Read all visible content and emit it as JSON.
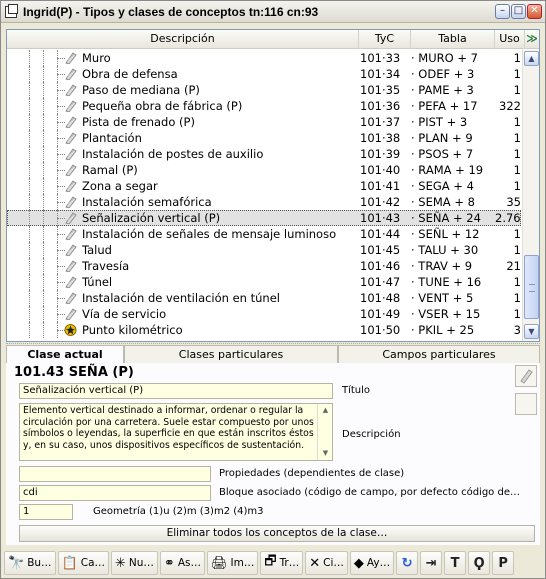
{
  "window": {
    "title": "Ingrid(P) - Tipos y clases de conceptos tn:116 cn:93",
    "minimize": "–",
    "maximize": "□",
    "close": "✕"
  },
  "grid": {
    "columns": {
      "descripcion": "Descripción",
      "tyc": "TyC",
      "tabla": "Tabla",
      "uso": "Uso",
      "extra": "≫"
    },
    "rows": [
      {
        "label": "Muro",
        "tyc": "101·33",
        "tabla": "· MURO + 7",
        "uso": "1"
      },
      {
        "label": "Obra de defensa",
        "tyc": "101·34",
        "tabla": "· ODEF + 3",
        "uso": "1"
      },
      {
        "label": "Paso de mediana (P)",
        "tyc": "101·35",
        "tabla": "· PAME + 3",
        "uso": "1"
      },
      {
        "label": "Pequeña obra de fábrica (P)",
        "tyc": "101·36",
        "tabla": "· PEFA + 17",
        "uso": "322"
      },
      {
        "label": "Pista de frenado (P)",
        "tyc": "101·37",
        "tabla": "· PIST + 3",
        "uso": "1"
      },
      {
        "label": "Plantación",
        "tyc": "101·38",
        "tabla": "· PLAN + 9",
        "uso": "1"
      },
      {
        "label": "Instalación de postes de auxilio",
        "tyc": "101·39",
        "tabla": "· PSOS + 7",
        "uso": "1"
      },
      {
        "label": "Ramal (P)",
        "tyc": "101·40",
        "tabla": "· RAMA + 19",
        "uso": "1"
      },
      {
        "label": "Zona a segar",
        "tyc": "101·41",
        "tabla": "· SEGA + 4",
        "uso": "1"
      },
      {
        "label": "Instalación semafórica",
        "tyc": "101·42",
        "tabla": "· SEMA + 8",
        "uso": "35"
      },
      {
        "label": "Señalización vertical (P)",
        "tyc": "101·43",
        "tabla": "· SEÑA + 24",
        "uso": "2.765",
        "selected": true
      },
      {
        "label": "Instalación de señales de mensaje luminoso",
        "tyc": "101·44",
        "tabla": "· SEÑL + 12",
        "uso": "1"
      },
      {
        "label": "Talud",
        "tyc": "101·45",
        "tabla": "· TALU + 30",
        "uso": "1"
      },
      {
        "label": "Travesía",
        "tyc": "101·46",
        "tabla": "· TRAV + 9",
        "uso": "21"
      },
      {
        "label": "Túnel",
        "tyc": "101·47",
        "tabla": "· TUNE + 16",
        "uso": "1"
      },
      {
        "label": "Instalación de ventilación en túnel",
        "tyc": "101·48",
        "tabla": "· VENT + 5",
        "uso": "1"
      },
      {
        "label": "Vía de servicio",
        "tyc": "101·49",
        "tabla": "· VSER + 15",
        "uso": "1"
      },
      {
        "label": "Punto kilométrico",
        "tyc": "101·50",
        "tabla": "· PKIL + 25",
        "uso": "3",
        "icon": "star"
      }
    ]
  },
  "tabs": [
    "Clase actual",
    "Clases particulares",
    "Campos particulares"
  ],
  "detail": {
    "heading": "101.43 SEÑA (P)",
    "title_value": "Señalización vertical (P)",
    "title_label": "Título",
    "description_text": "Elemento vertical destinado a informar, ordenar o regular la circulación por una carretera. Suele estar compuesto por unos símbolos o leyendas, la superficie en que están inscritos éstos y, en su caso, unos dispositivos específicos de sustentación.",
    "description_label": "Descripción",
    "properties_value": "",
    "properties_label": "Propiedades (dependientes de clase)",
    "block_value": "cdi",
    "block_label": "Bloque asociado (código de campo, por defecto código de…",
    "geometry_value": "1",
    "geometry_label": "Geometría (1)u (2)m (3)m2 (4)m3",
    "delete_button": "Eliminar todos los conceptos de la clase…"
  },
  "toolbar": [
    {
      "glyph": "🔭",
      "label": "Bu…"
    },
    {
      "glyph": "📋",
      "label": "Ca…"
    },
    {
      "glyph": "✳",
      "label": "Nu…"
    },
    {
      "glyph": "⚭",
      "label": "As…"
    },
    {
      "glyph": "🖨",
      "label": "Im…"
    },
    {
      "glyph": "🗗",
      "label": "Tr…"
    },
    {
      "glyph": "✕",
      "label": "Ci…"
    },
    {
      "glyph": "◆",
      "label": "Ay…"
    }
  ],
  "toolbar_icons": [
    "refresh-icon",
    "export-icon",
    "field-icon",
    "field-list-icon",
    "print-preview-icon"
  ],
  "colors": {
    "field_bg": "#ffffe1",
    "selected_row": "#e2e2e2",
    "accent_blue": "#3b6fd6"
  }
}
